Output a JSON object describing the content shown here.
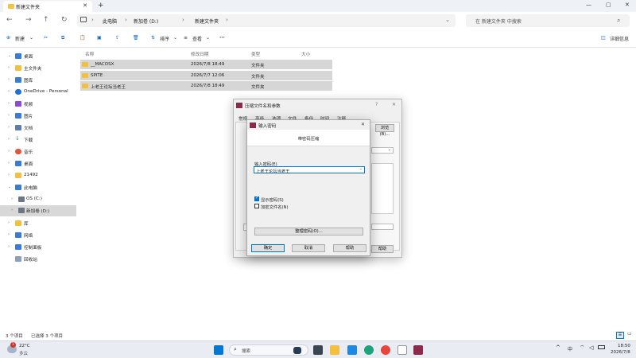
{
  "window": {
    "tab_title": "新建文件夹",
    "new_tab": "+",
    "minimize": "—",
    "maximize": "▢",
    "close": "✕"
  },
  "address": {
    "crumbs": [
      "此电脑",
      "新加卷 (D:)",
      "新建文件夹"
    ],
    "search_placeholder": "在 新建文件夹 中搜索"
  },
  "toolbar": {
    "new": "新建",
    "sort": "排序",
    "view": "查看",
    "more": "···",
    "details": "详细信息"
  },
  "sidebar": {
    "items": [
      {
        "label": "桌面",
        "color": "#3a7bd5"
      },
      {
        "label": "主文件夹",
        "color": "#f2c03c"
      },
      {
        "label": "图库",
        "color": "#3a7bd5"
      },
      {
        "label": "OneDrive - Personal",
        "color": "#1e6fd9"
      },
      {
        "label": "视频",
        "color": "#8a4cd0"
      },
      {
        "label": "图片",
        "color": "#3a7bd5"
      },
      {
        "label": "文档",
        "color": "#5b7fa8"
      },
      {
        "label": "下载",
        "color": "#2f8f5b"
      },
      {
        "label": "音乐",
        "color": "#e2553a"
      },
      {
        "label": "桌面",
        "color": "#3a7bd5"
      },
      {
        "label": "21492",
        "color": "#f2c03c"
      },
      {
        "label": "此电脑",
        "color": "#3a7bd5"
      },
      {
        "label": "OS (C:)",
        "color": "#6b7785"
      },
      {
        "label": "新加卷 (D:)",
        "color": "#6b7785"
      },
      {
        "label": "库",
        "color": "#f2c03c"
      },
      {
        "label": "网络",
        "color": "#3a7bd5"
      },
      {
        "label": "控制面板",
        "color": "#3a7bd5"
      },
      {
        "label": "回收站",
        "color": "#8aa0b8"
      }
    ]
  },
  "columns": {
    "name": "名称",
    "modified": "修改日期",
    "type": "类型",
    "size": "大小"
  },
  "files": [
    {
      "name": "__MACOSX",
      "modified": "2026/7/8 18:49",
      "type": "文件夹"
    },
    {
      "name": "SPITE",
      "modified": "2026/7/7 12:06",
      "type": "文件夹"
    },
    {
      "name": "上老王论坛当老王",
      "modified": "2026/7/8 18:49",
      "type": "文件夹"
    }
  ],
  "status": {
    "count": "3 个项目",
    "selected": "已选择 3 个项目"
  },
  "archive_dialog": {
    "title": "压缩文件名和参数",
    "help": "?",
    "close": "✕",
    "tabs": [
      "常规",
      "高级",
      "选项",
      "文件",
      "备份",
      "时间",
      "注释"
    ],
    "browse": "浏览(B)...",
    "help_btn": "帮助"
  },
  "password_dialog": {
    "title": "输入密码",
    "close": "✕",
    "subtitle": "带密码压缩",
    "label": "输入密码(E)",
    "value": "上老王论坛当老王",
    "show_password": "显示密码(S)",
    "encrypt_names": "加密文件名(N)",
    "organize": "整理密码(O)...",
    "ok": "确定",
    "cancel": "取消",
    "help": "帮助"
  },
  "taskbar": {
    "temp": "22°C",
    "weather": "多云",
    "search": "搜索",
    "ime": "中",
    "time": "18:50",
    "date": "2026/7/8",
    "weather_badge": "1"
  }
}
